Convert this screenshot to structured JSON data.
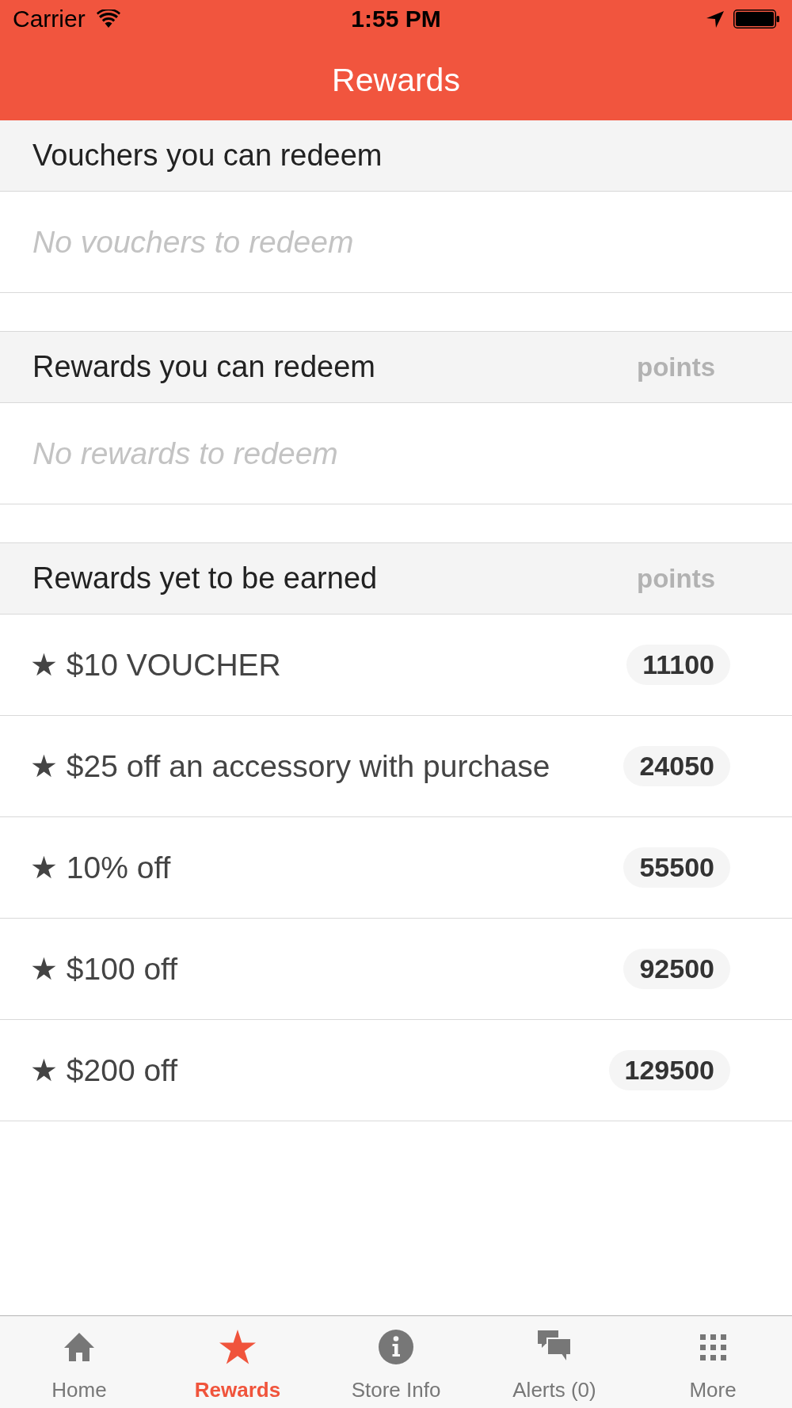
{
  "status_bar": {
    "carrier": "Carrier",
    "time": "1:55 PM"
  },
  "nav_bar": {
    "title": "Rewards"
  },
  "sections": [
    {
      "title": "Vouchers you can redeem",
      "empty_text": "No vouchers to redeem"
    },
    {
      "title": "Rewards you can redeem",
      "column_label": "points",
      "empty_text": "No rewards to redeem"
    },
    {
      "title": "Rewards yet to be earned",
      "column_label": "points",
      "items": [
        {
          "label": "★ $10 VOUCHER",
          "points": "11100"
        },
        {
          "label": "★ $25 off an accessory with purchase",
          "points": "24050"
        },
        {
          "label": "★ 10% off",
          "points": "55500"
        },
        {
          "label": "★ $100 off",
          "points": "92500"
        },
        {
          "label": "★ $200 off",
          "points": "129500"
        }
      ]
    }
  ],
  "tab_bar": {
    "tabs": [
      {
        "kind": "home",
        "label": "Home",
        "selected": false
      },
      {
        "kind": "rewards",
        "label": "Rewards",
        "selected": true
      },
      {
        "kind": "info",
        "label": "Store Info",
        "selected": false
      },
      {
        "kind": "alerts",
        "label": "Alerts (0)",
        "selected": false
      },
      {
        "kind": "more",
        "label": "More",
        "selected": false
      }
    ]
  }
}
